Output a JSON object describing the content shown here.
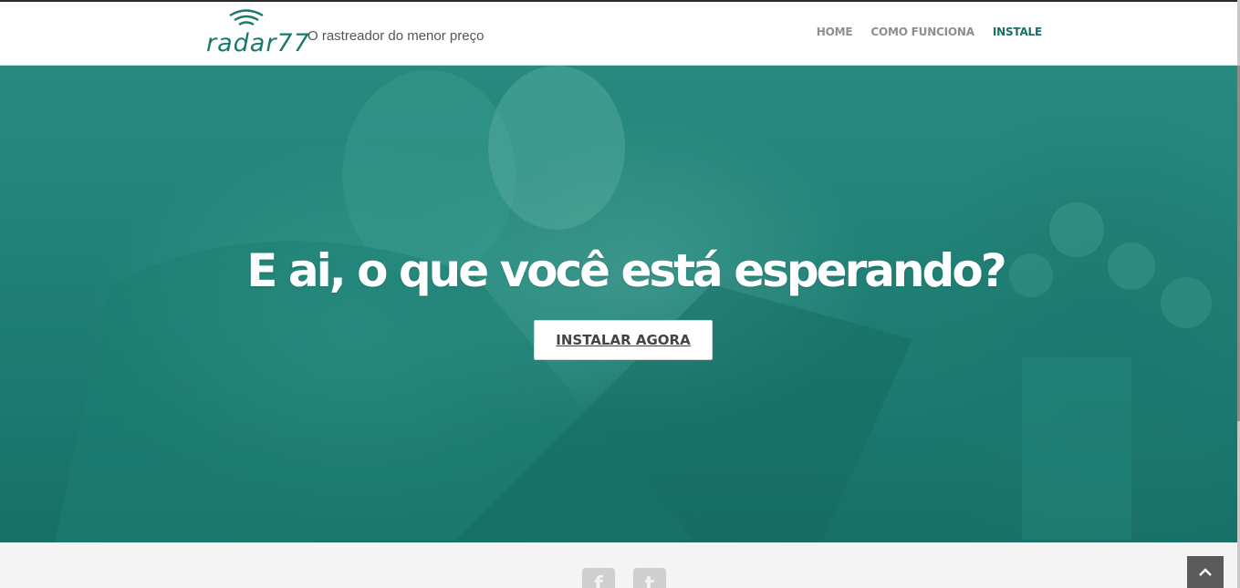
{
  "header": {
    "logo_text": "radar77",
    "tagline": "O rastreador do menor preço",
    "nav": [
      {
        "label": "HOME",
        "active": false
      },
      {
        "label": "COMO FUNCIONA",
        "active": false
      },
      {
        "label": "INSTALE",
        "active": true
      }
    ]
  },
  "hero": {
    "title": "E ai, o que você está esperando?",
    "cta_label": "INSTALAR AGORA"
  },
  "footer": {
    "social": [
      {
        "icon": "facebook-icon",
        "glyph": "f"
      },
      {
        "icon": "twitter-icon",
        "glyph": "t"
      }
    ],
    "scroll_top_icon": "chevron-up-icon"
  },
  "colors": {
    "brand": "#1a7a6c",
    "nav_active": "#1a7068",
    "nav_inactive": "#8e8e8e",
    "hero_overlay": "#23857a"
  }
}
